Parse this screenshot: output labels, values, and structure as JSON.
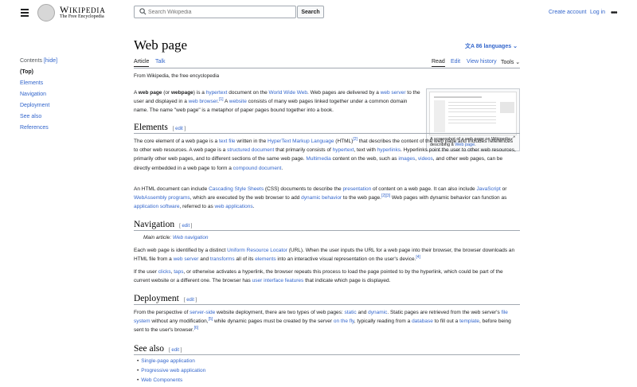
{
  "header": {
    "logo_title": "Wikipedia",
    "logo_subtitle": "The Free Encyclopedia",
    "search_placeholder": "Search Wikipedia",
    "search_button": "Search",
    "create_account": "Create account",
    "login": "Log in",
    "more": "•••"
  },
  "toc": {
    "label": "Contents",
    "hide": "[hide]",
    "items": [
      "(Top)",
      "Elements",
      "Navigation",
      "Deployment",
      "See also",
      "References"
    ]
  },
  "article": {
    "title": "Web page",
    "languages": "86 languages",
    "tabs": {
      "article": "Article",
      "talk": "Talk",
      "read": "Read",
      "edit": "Edit",
      "history": "View history",
      "tools": "Tools"
    },
    "tagline": "From Wikipedia, the free encyclopedia",
    "thumb_caption_prefix": "A screenshot of a web page on Wikipedia describing a ",
    "thumb_caption_link": "Web page",
    "thumb_caption_suffix": ".",
    "edit_label": "edit",
    "sections": {
      "elements": "Elements",
      "navigation": "Navigation",
      "deployment": "Deployment",
      "see_also": "See also"
    },
    "main_article_label": "Main article: ",
    "main_article_link": "Web navigation",
    "see_also_items": [
      "Single-page application",
      "Progressive web application",
      "Web Components"
    ]
  },
  "colors": {
    "link": "#3366cc",
    "text": "#202122",
    "border": "#a2a9b1"
  }
}
